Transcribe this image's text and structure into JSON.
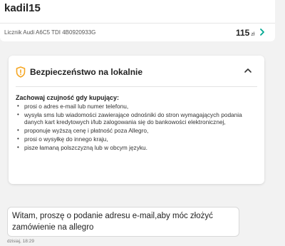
{
  "header": {
    "username": "kadil15"
  },
  "product": {
    "title": "Licznik Audi A6C5 TDI 4B0920933G",
    "price": "115",
    "currency": "zł",
    "chevron_icon": "chevron-right-icon",
    "accent_color": "#00a790"
  },
  "safety": {
    "title": "Bezpieczeństwo na lokalnie",
    "icon": "shield-alert-icon",
    "icon_color": "#f5a623",
    "heading": "Zachowaj czujność gdy kupujący:",
    "items": [
      "prosi o adres e-mail lub numer telefonu,",
      "wysyła sms lub wiadomości zawierające odnośniki do stron wymagających podania danych kart kredytowych i/lub zalogowania się do bankowości elektronicznej,",
      "proponuje wyższą cenę i płatność poza Allegro,",
      "prosi o wysyłkę do innego kraju,",
      "pisze łamaną polszczyzną lub w obcym języku."
    ]
  },
  "message": {
    "text": "Witam, proszę o podanie adresu e-mail,aby móc złożyć zamówienie na allegro",
    "timestamp": "dzisiaj, 18:29"
  }
}
